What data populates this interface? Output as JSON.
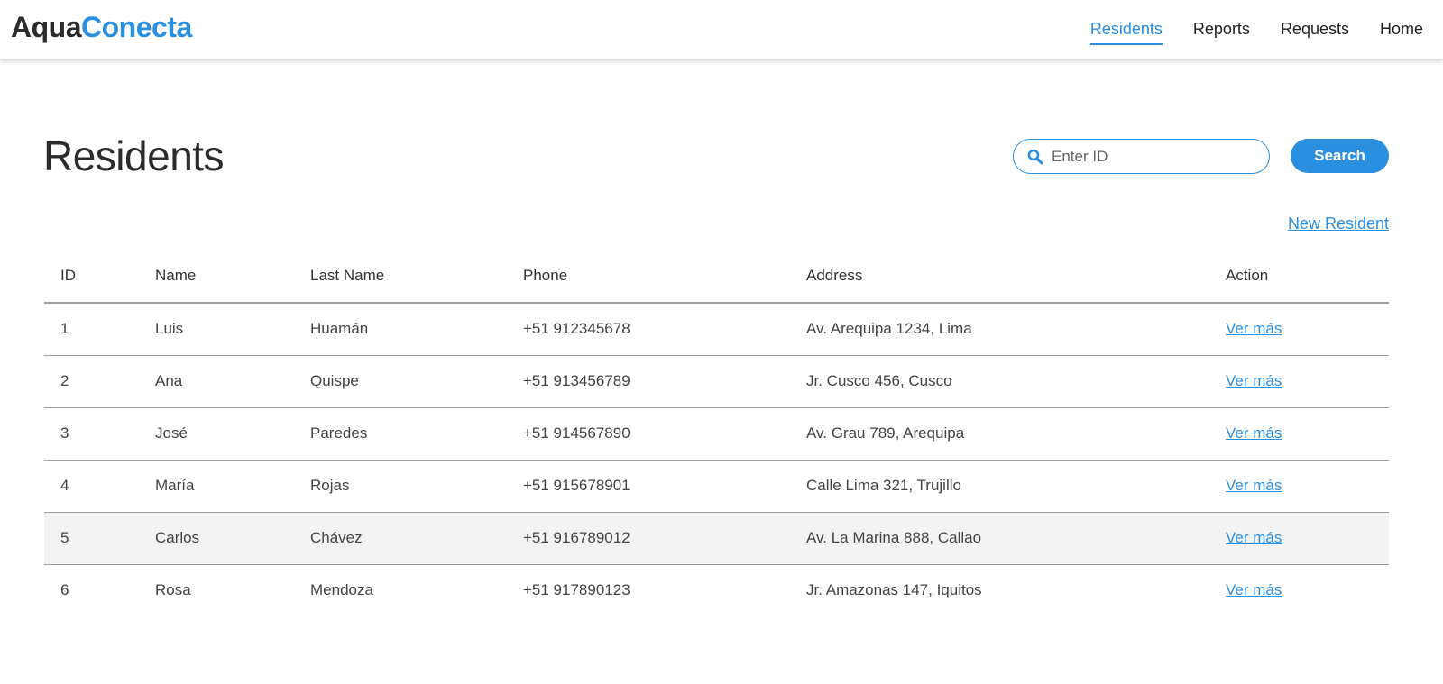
{
  "header": {
    "logo_part1": "Aqua",
    "logo_part2": "Conecta",
    "nav": [
      {
        "label": "Residents",
        "active": true
      },
      {
        "label": "Reports"
      },
      {
        "label": "Requests"
      },
      {
        "label": "Home"
      }
    ]
  },
  "main": {
    "title": "Residents",
    "search": {
      "placeholder": "Enter ID",
      "value": "",
      "button_label": "Search"
    },
    "new_resident_label": "New Resident"
  },
  "table": {
    "columns": [
      "ID",
      "Name",
      "Last Name",
      "Phone",
      "Address",
      "Action"
    ],
    "rows": [
      {
        "id": "1",
        "name": "Luis",
        "last_name": "Huamán",
        "phone": "+51 912345678",
        "address": "Av. Arequipa 1234, Lima",
        "action": "Ver más"
      },
      {
        "id": "2",
        "name": "Ana",
        "last_name": "Quispe",
        "phone": "+51 913456789",
        "address": "Jr. Cusco 456, Cusco",
        "action": "Ver más"
      },
      {
        "id": "3",
        "name": "José",
        "last_name": "Paredes",
        "phone": "+51 914567890",
        "address": "Av. Grau 789, Arequipa",
        "action": "Ver más"
      },
      {
        "id": "4",
        "name": "María",
        "last_name": "Rojas",
        "phone": "+51 915678901",
        "address": "Calle Lima 321, Trujillo",
        "action": "Ver más"
      },
      {
        "id": "5",
        "name": "Carlos",
        "last_name": "Chávez",
        "phone": "+51 916789012",
        "address": "Av. La Marina 888, Callao",
        "action": "Ver más",
        "highlighted": true
      },
      {
        "id": "6",
        "name": "Rosa",
        "last_name": "Mendoza",
        "phone": "+51 917890123",
        "address": "Jr. Amazonas 147, Iquitos",
        "action": "Ver más"
      }
    ]
  },
  "colors": {
    "accent": "#2b8fe0",
    "text": "#333333",
    "row_highlight": "#f3f3f3"
  },
  "icons": {
    "search": "search-icon"
  }
}
